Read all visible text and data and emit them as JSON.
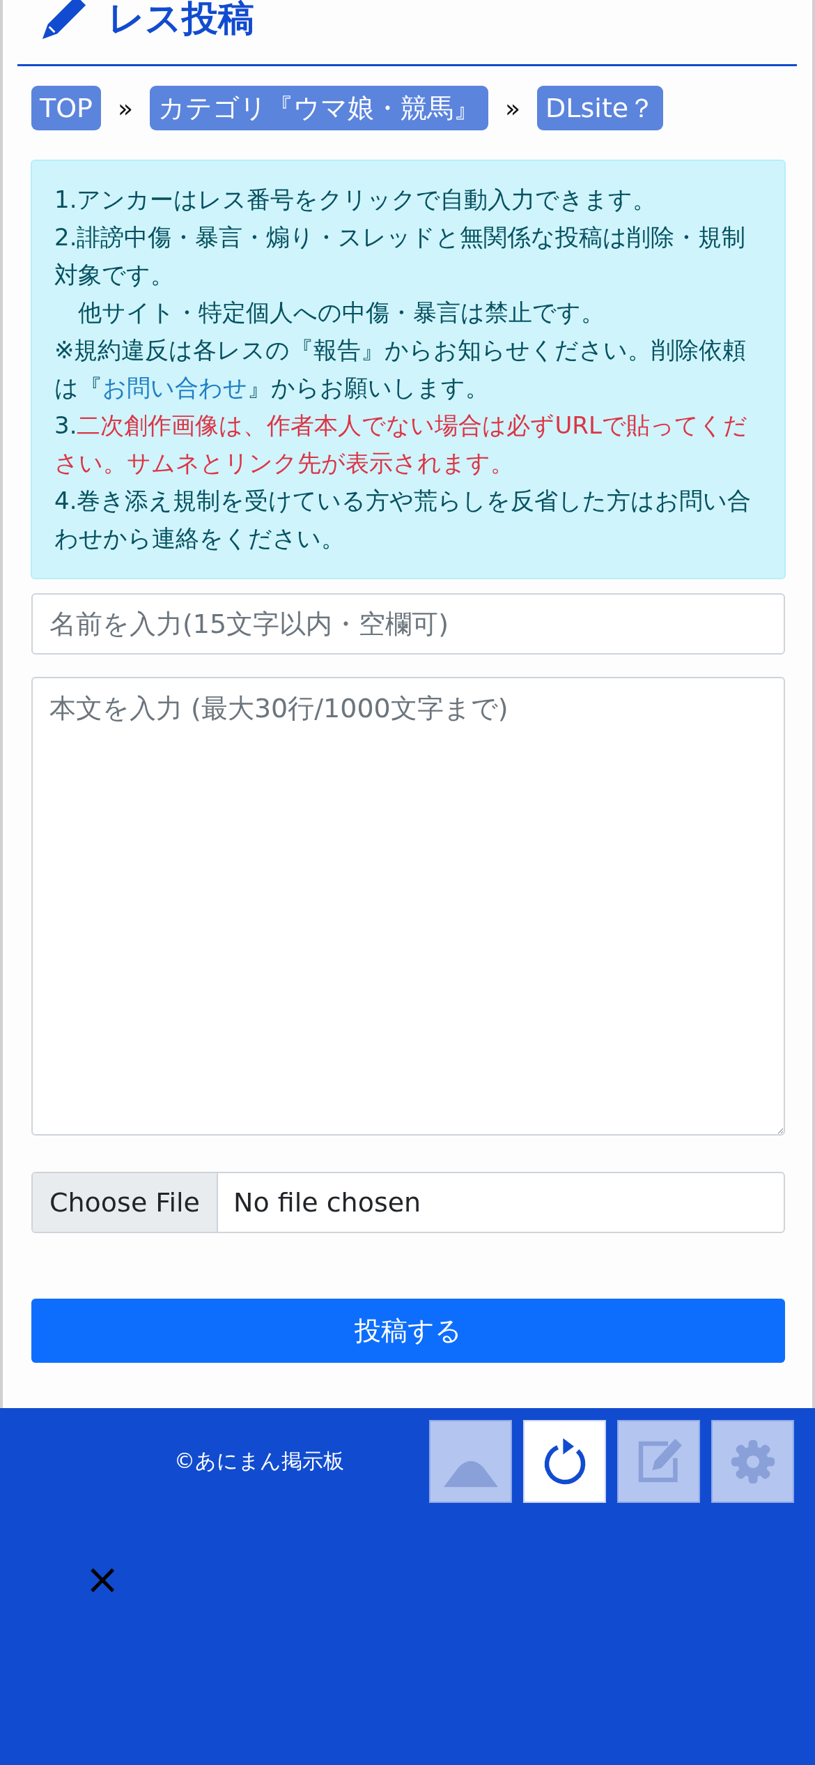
{
  "header": {
    "title": "レス投稿"
  },
  "breadcrumbs": [
    {
      "label": "TOP",
      "separator": "»"
    },
    {
      "label": "カテゴリ『ウマ娘・競馬』",
      "separator": "»"
    },
    {
      "label": "DLsite？"
    }
  ],
  "notice": {
    "paragraphs": [
      [
        {
          "kind": "text",
          "text": "1.アンカーはレス番号をクリックで自動入力できます。"
        }
      ],
      [
        {
          "kind": "text",
          "text": "2.誹謗中傷・暴言・煽り・スレッドと無関係な投稿は削除・規制対象です。"
        }
      ],
      [
        {
          "kind": "text",
          "text": "　他サイト・特定個人への中傷・暴言は禁止です。"
        }
      ],
      [
        {
          "kind": "text",
          "text": "※規約違反は各レスの『報告』からお知らせください。削除依頼は『"
        },
        {
          "kind": "link",
          "text": "お問い合わせ"
        },
        {
          "kind": "text",
          "text": "』からお願いします。"
        }
      ],
      [
        {
          "kind": "text",
          "text": "3."
        },
        {
          "kind": "warning",
          "text": "二次創作画像は、作者本人でない場合は必ずURLで貼ってください。サムネとリンク先が表示されます。"
        }
      ],
      [
        {
          "kind": "text",
          "text": "4.巻き添え規制を受けている方や荒らしを反省した方はお問い合わせから連絡をください。"
        }
      ]
    ]
  },
  "form": {
    "name_placeholder": "名前を入力(15文字以内・空欄可)",
    "body_placeholder": "本文を入力 (最大30行/1000文字まで)",
    "file_button": "Choose File",
    "file_status": "No file chosen",
    "submit": "投稿する"
  },
  "footer": {
    "copyright": "©あにまん掲示板"
  },
  "floating_buttons": [
    {
      "kind": "up",
      "active": false
    },
    {
      "kind": "reload",
      "active": true
    },
    {
      "kind": "edit",
      "active": false
    },
    {
      "kind": "settings",
      "active": false
    }
  ],
  "close_mark": "×"
}
